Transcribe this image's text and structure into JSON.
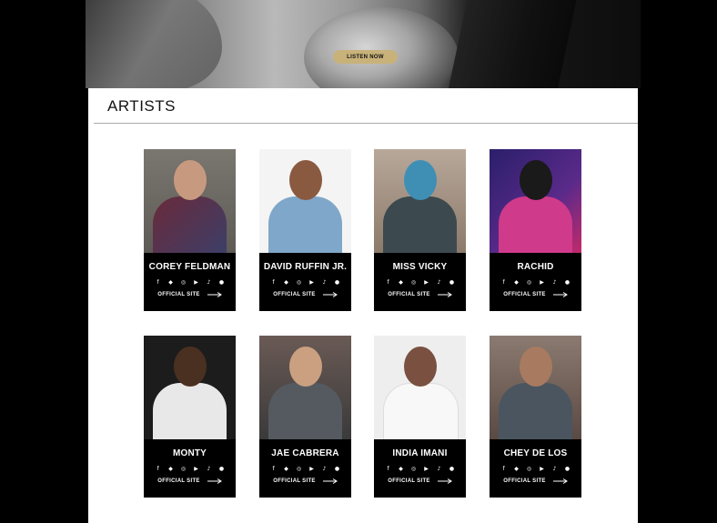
{
  "hero": {
    "button_label": "LISTEN NOW",
    "accent": "#c8b27a"
  },
  "section": {
    "title": "ARTISTS"
  },
  "social_icons": [
    "facebook-icon",
    "twitter-icon",
    "instagram-icon",
    "youtube-icon",
    "tiktok-icon",
    "spotify-icon"
  ],
  "artists": [
    {
      "name": "COREY FELDMAN",
      "link_label": "OFFICIAL SITE"
    },
    {
      "name": "DAVID RUFFIN JR.",
      "link_label": "OFFICIAL SITE"
    },
    {
      "name": "MISS VICKY",
      "link_label": "OFFICIAL SITE"
    },
    {
      "name": "RACHID",
      "link_label": "OFFICIAL SITE"
    },
    {
      "name": "MONTY",
      "link_label": "OFFICIAL SITE"
    },
    {
      "name": "JAE CABRERA",
      "link_label": "OFFICIAL SITE"
    },
    {
      "name": "INDIA IMANI",
      "link_label": "OFFICIAL SITE"
    },
    {
      "name": "CHEY DE LOS",
      "link_label": "OFFICIAL SITE"
    }
  ]
}
